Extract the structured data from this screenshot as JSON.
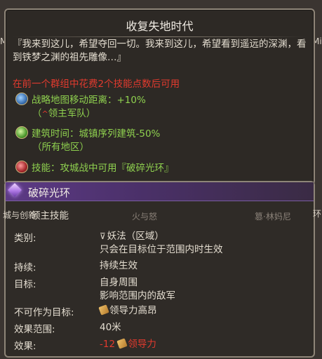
{
  "background": {
    "left_label": "Mi",
    "right_label": "Mi",
    "bottom_left_label": "城与创新",
    "bottom_mid_label": "火与怒",
    "bottom_right_label": "篡·林妈尼",
    "far_right_label": "环"
  },
  "tooltip": {
    "title": "收复失地时代",
    "quote": "『我来到这儿，希望夺回一切。我来到这儿，希望看到遥远的深渊，看到铁梦之渊的祖先雕像…』",
    "requirement": "在前一个群组中花费2个技能点数后可用",
    "bonuses": [
      {
        "icon": "compass-icon",
        "line1": "战略地图移动距离：+10%",
        "line2_prefix": "（",
        "line2_glyph": "^",
        "line2": "领主军队）"
      },
      {
        "icon": "hammer-icon",
        "line1": "建筑时间：城镇序列建筑-50%",
        "line2": "（所有地区）"
      },
      {
        "icon": "skill-icon",
        "line1": "技能：攻城战中可用『破碎光环』"
      }
    ]
  },
  "skill": {
    "name": "破碎光环",
    "type": "领主技能",
    "attributes": [
      {
        "label": "类别:",
        "value_glyph": "⊽",
        "value": "妖法（区域）",
        "value2": "只会在目标位于范围内时生效"
      },
      {
        "label": "持续:",
        "value": "持续生效"
      },
      {
        "label": "目标:",
        "value": "自身周围",
        "value2": "影响范围内的敌军"
      },
      {
        "label": "不可作为目标:",
        "value": "领导力高昂"
      },
      {
        "label": "效果范围:",
        "value": "40米"
      },
      {
        "label": "效果:",
        "value": "-12",
        "value_suffix": "领导力"
      }
    ]
  },
  "colors": {
    "accent_purple": "#5d3a86",
    "bonus_green": "#8fd14f",
    "warning_red": "#e23a2e"
  }
}
